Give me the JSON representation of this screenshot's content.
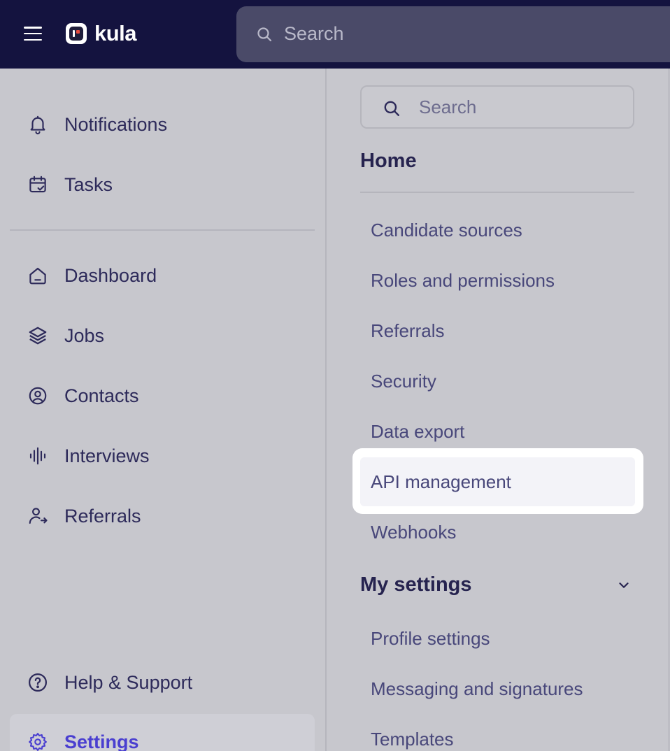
{
  "app": {
    "name": "kula"
  },
  "topbar": {
    "search_placeholder": "Search"
  },
  "sidebar": {
    "top_items": [
      {
        "label": "Notifications",
        "icon": "bell-icon"
      },
      {
        "label": "Tasks",
        "icon": "calendar-check-icon"
      }
    ],
    "main_items": [
      {
        "label": "Dashboard",
        "icon": "home-icon"
      },
      {
        "label": "Jobs",
        "icon": "layers-icon"
      },
      {
        "label": "Contacts",
        "icon": "user-circle-icon"
      },
      {
        "label": "Interviews",
        "icon": "audio-wave-icon"
      },
      {
        "label": "Referrals",
        "icon": "user-share-icon"
      }
    ],
    "bottom_items": [
      {
        "label": "Help & Support",
        "icon": "question-circle-icon"
      },
      {
        "label": "Settings",
        "icon": "gear-icon",
        "active": true
      }
    ]
  },
  "panel": {
    "search_placeholder": "Search",
    "home": {
      "title": "Home",
      "links": [
        "Candidate sources",
        "Roles and permissions",
        "Referrals",
        "Security",
        "Data export",
        "API management",
        "Webhooks"
      ],
      "highlighted": "API management"
    },
    "my_settings": {
      "title": "My settings",
      "links": [
        "Profile settings",
        "Messaging and signatures",
        "Templates"
      ]
    }
  },
  "colors": {
    "topbar": "#14133f",
    "accent": "#4a3fd0",
    "text": "#2d2a5a",
    "link": "#48477a"
  }
}
